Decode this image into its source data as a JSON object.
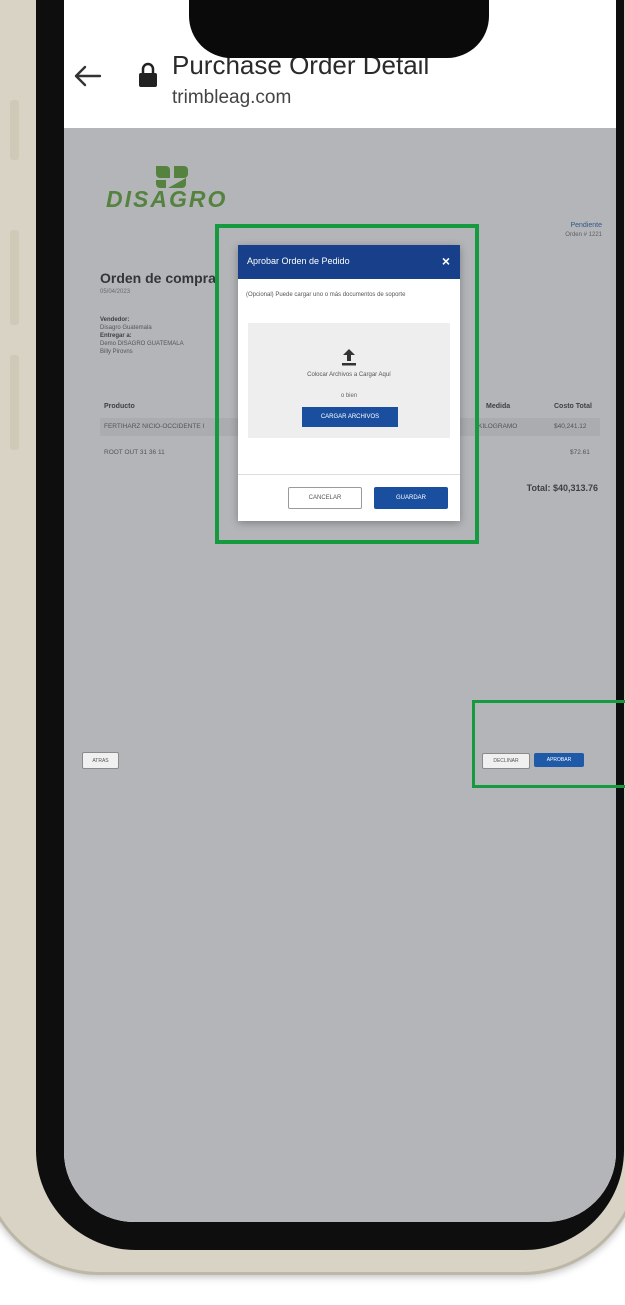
{
  "browser": {
    "title": "Purchase Order Detail",
    "url": "trimbleag.com"
  },
  "page": {
    "logo": "DISAGRO",
    "status": "Pendiente",
    "order_number": "Orden # 1221",
    "title": "Orden de compra",
    "date": "05/04/2023",
    "vendor_label": "Vendedor:",
    "vendor_value": "Disagro Guatemala",
    "deliver_label": "Entregar a:",
    "deliver_value": "Demo DISAGRO GUATEMALA",
    "deliver_contact": "Billy Pirovns",
    "columns": [
      "Producto",
      "Medida",
      "Costo Total"
    ],
    "rows": [
      {
        "product": "FERTIHARZ NICIO-OCCIDENTE I",
        "unit": "KILOGRAMO",
        "cost": "$40,241.12"
      },
      {
        "product": "ROOT OUT 31 36 11",
        "unit": "",
        "cost": "$72.61"
      }
    ],
    "total": "Total: $40,313.76",
    "back_button": "ATRAS",
    "reject_button": "DECLINAR",
    "approve_button": "APROBAR"
  },
  "modal": {
    "title": "Aprobar Orden de Pedido",
    "close_symbol": "×",
    "description": "(Opcional) Puede cargar uno o más documentos de soporte",
    "upload_text": "Colocar Archivos a Cargar Aquí",
    "or_text": "o bien",
    "upload_button": "CARGAR ARCHIVOS",
    "cancel_button": "CANCELAR",
    "save_button": "GUARDAR"
  },
  "colors": {
    "brand_green": "#5aa02c",
    "modal_header": "#173f8a",
    "primary_button": "#1a4f9f",
    "highlight": "#169a3f"
  }
}
